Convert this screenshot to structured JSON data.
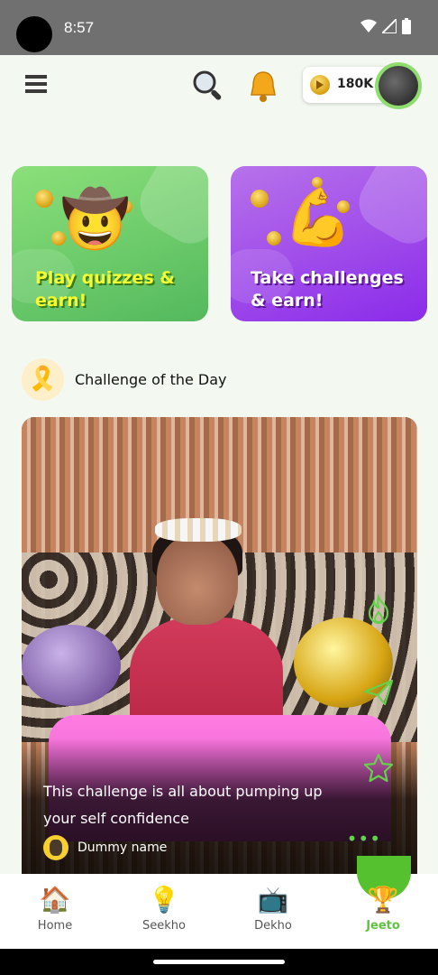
{
  "status_bar": {
    "time": "8:57"
  },
  "header": {
    "coins_value": "180K",
    "icons": [
      "menu-icon",
      "search-icon",
      "bell-icon",
      "coin-icon",
      "avatar"
    ]
  },
  "promo_cards": [
    {
      "title": "Play quizzes & earn!",
      "emoji": "cowboy-face"
    },
    {
      "title": "Take challenges & earn!",
      "emoji": "flexed-biceps"
    }
  ],
  "challenge_section": {
    "title": "Challenge of the Day",
    "post": {
      "description": "This challenge is all about pumping up your self confidence",
      "user_name": "Dummy name",
      "actions": [
        "fire-icon",
        "share-icon",
        "star-icon",
        "more-icon"
      ]
    }
  },
  "bottom_nav": {
    "items": [
      {
        "label": "Home",
        "icon": "home-icon"
      },
      {
        "label": "Seekho",
        "icon": "bulb-icon"
      },
      {
        "label": "Dekho",
        "icon": "tv-icon"
      },
      {
        "label": "Jeeto",
        "icon": "trophy-icon"
      }
    ],
    "active": "Jeeto"
  },
  "colors": {
    "accent": "#5fc341",
    "green_card": "#6fd16c",
    "purple_card": "#a24bea",
    "background": "#f3f9f1"
  }
}
